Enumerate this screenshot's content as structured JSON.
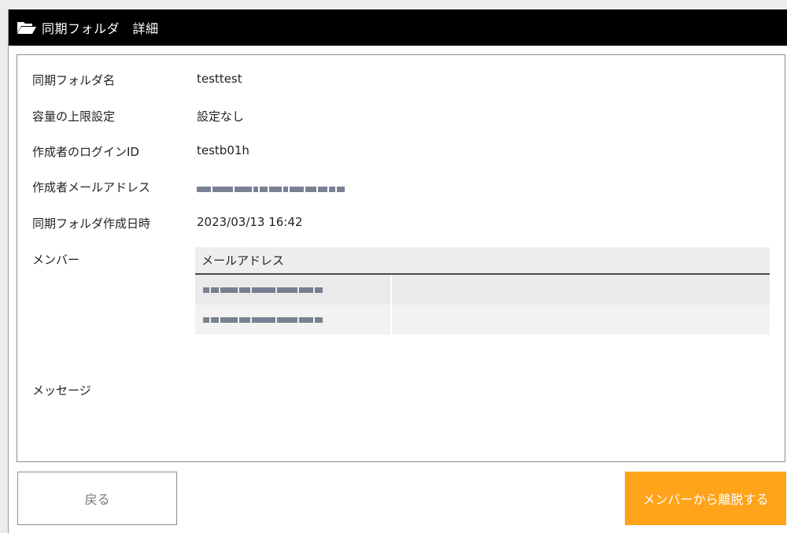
{
  "window": {
    "title": "同期フォルダ　詳細",
    "icon": "folder-open-icon"
  },
  "details": {
    "folder_name_label": "同期フォルダ名",
    "folder_name_value": "testtest",
    "capacity_label": "容量の上限設定",
    "capacity_value": "設定なし",
    "creator_login_label": "作成者のログインID",
    "creator_login_value": "testb01h",
    "creator_email_label": "作成者メールアドレス",
    "creator_email_value": "",
    "created_at_label": "同期フォルダ作成日時",
    "created_at_value": "2023/03/13 16:42",
    "members_label": "メンバー",
    "message_label": "メッセージ"
  },
  "members_table": {
    "column_header": "メールアドレス",
    "rows": [
      {
        "email": ""
      },
      {
        "email": ""
      }
    ]
  },
  "buttons": {
    "back_label": "戻る",
    "leave_label": "メンバーから離脱する"
  },
  "colors": {
    "titlebar": "#000000",
    "leave_button": "#ffa31a",
    "back_button_text": "#777777"
  }
}
